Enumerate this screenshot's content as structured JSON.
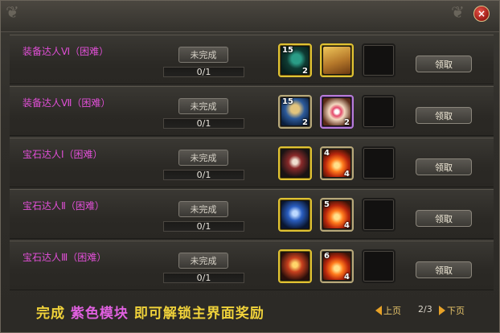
{
  "window": {
    "close_glyph": "×",
    "corner_glyph": "❦"
  },
  "quests": [
    {
      "name": "装备达人Ⅵ（困难）",
      "status": "未完成",
      "progress": "0/1",
      "claim": "领取",
      "rewards": [
        {
          "icon": "trident-icon",
          "frame": "gold",
          "tl": "15",
          "br": "2"
        },
        {
          "icon": "scroll-icon",
          "frame": "gold",
          "tl": "",
          "br": ""
        },
        {
          "icon": "empty-slot",
          "frame": "",
          "tl": "",
          "br": ""
        }
      ]
    },
    {
      "name": "装备达人Ⅶ（困难）",
      "status": "未完成",
      "progress": "0/1",
      "claim": "领取",
      "rewards": [
        {
          "icon": "hammer-icon",
          "frame": "tan",
          "tl": "15",
          "br": "2"
        },
        {
          "icon": "orb-icon",
          "frame": "lilac",
          "tl": "",
          "br": "2"
        },
        {
          "icon": "empty-slot",
          "frame": "",
          "tl": "",
          "br": ""
        }
      ]
    },
    {
      "name": "宝石达人Ⅰ（困难）",
      "status": "未完成",
      "progress": "0/1",
      "claim": "领取",
      "rewards": [
        {
          "icon": "swordsman-icon",
          "frame": "gold",
          "tl": "",
          "br": ""
        },
        {
          "icon": "flame-gem-icon",
          "frame": "tan",
          "tl": "4",
          "br": "4"
        },
        {
          "icon": "empty-slot",
          "frame": "",
          "tl": "",
          "br": ""
        }
      ]
    },
    {
      "name": "宝石达人Ⅱ（困难）",
      "status": "未完成",
      "progress": "0/1",
      "claim": "领取",
      "rewards": [
        {
          "icon": "swordsman-icon",
          "frame": "gold",
          "tl": "",
          "br": ""
        },
        {
          "icon": "flame-gem-icon",
          "frame": "tan",
          "tl": "5",
          "br": "4"
        },
        {
          "icon": "empty-slot",
          "frame": "",
          "tl": "",
          "br": ""
        }
      ]
    },
    {
      "name": "宝石达人Ⅲ（困难）",
      "status": "未完成",
      "progress": "0/1",
      "claim": "领取",
      "rewards": [
        {
          "icon": "swordsman-icon",
          "frame": "gold",
          "tl": "",
          "br": ""
        },
        {
          "icon": "flame-gem-icon",
          "frame": "tan",
          "tl": "6",
          "br": "4"
        },
        {
          "icon": "empty-slot",
          "frame": "",
          "tl": "",
          "br": ""
        }
      ]
    }
  ],
  "footer": {
    "banner_a": "完成",
    "banner_b": "紫色模块",
    "banner_c": "即可解锁主界面奖励",
    "prev": "上页",
    "page": "2/3",
    "next": "下页"
  },
  "colors": {
    "quest_name": "#e04fd6",
    "banner_yellow": "#f0d23a",
    "banner_purple": "#e060e0"
  }
}
